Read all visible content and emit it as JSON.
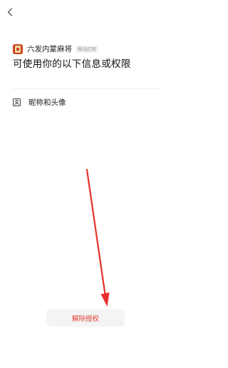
{
  "header": {
    "back_icon": "chevron-left-icon"
  },
  "app": {
    "name": "六发内蒙麻将",
    "tag": "移动应用",
    "icon": "mahjong-app-icon"
  },
  "page": {
    "title": "可使用你的以下信息或权限"
  },
  "permissions": [
    {
      "label": "昵称和头像",
      "icon": "user-portrait-icon"
    }
  ],
  "actions": {
    "revoke_label": "解除授权"
  },
  "colors": {
    "danger": "#e2412f",
    "button_bg": "#f4f4f4",
    "annotation_arrow": "#e8302a"
  }
}
